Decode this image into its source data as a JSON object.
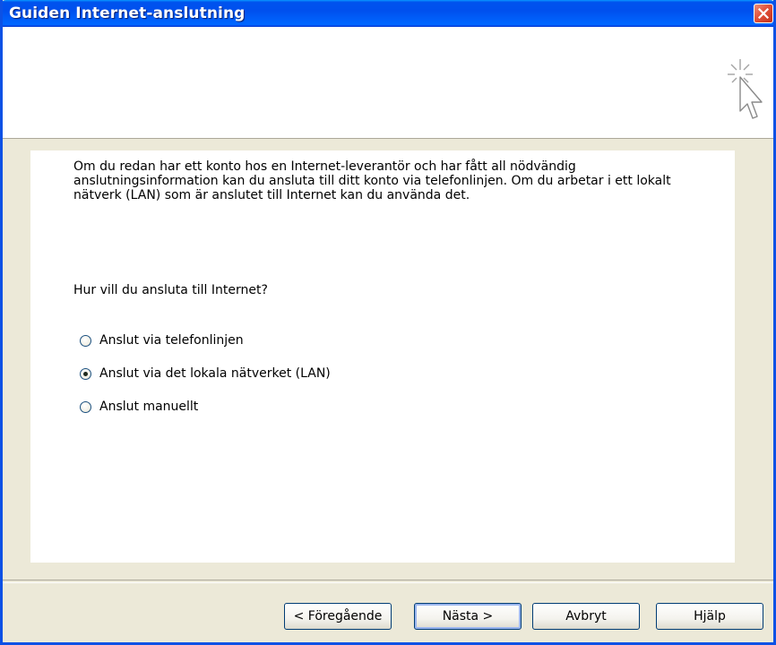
{
  "window": {
    "title": "Guiden Internet-anslutning"
  },
  "intro": {
    "text": "Om du redan har ett konto hos en Internet-leverantör och har fått all nödvändig anslutningsinformation kan du ansluta till ditt konto via telefonlinjen. Om du arbetar i ett lokalt nätverk (LAN) som är anslutet till Internet kan du använda det."
  },
  "question": {
    "text": "Hur vill du ansluta till Internet?"
  },
  "options": [
    {
      "label": "Anslut via telefonlinjen",
      "checked": false
    },
    {
      "label": "Anslut via det lokala nätverket (LAN)",
      "checked": true
    },
    {
      "label": "Anslut manuellt",
      "checked": false
    }
  ],
  "buttons": {
    "back": "< Föregående",
    "next": "Nästa >",
    "cancel": "Avbryt",
    "help": "Hjälp"
  },
  "icons": {
    "close": "close-icon",
    "wizard": "cursor-sparkle-icon"
  },
  "colors": {
    "titlebar": "#0054e3",
    "window_bg": "#ece9d8",
    "close": "#e2513a"
  }
}
